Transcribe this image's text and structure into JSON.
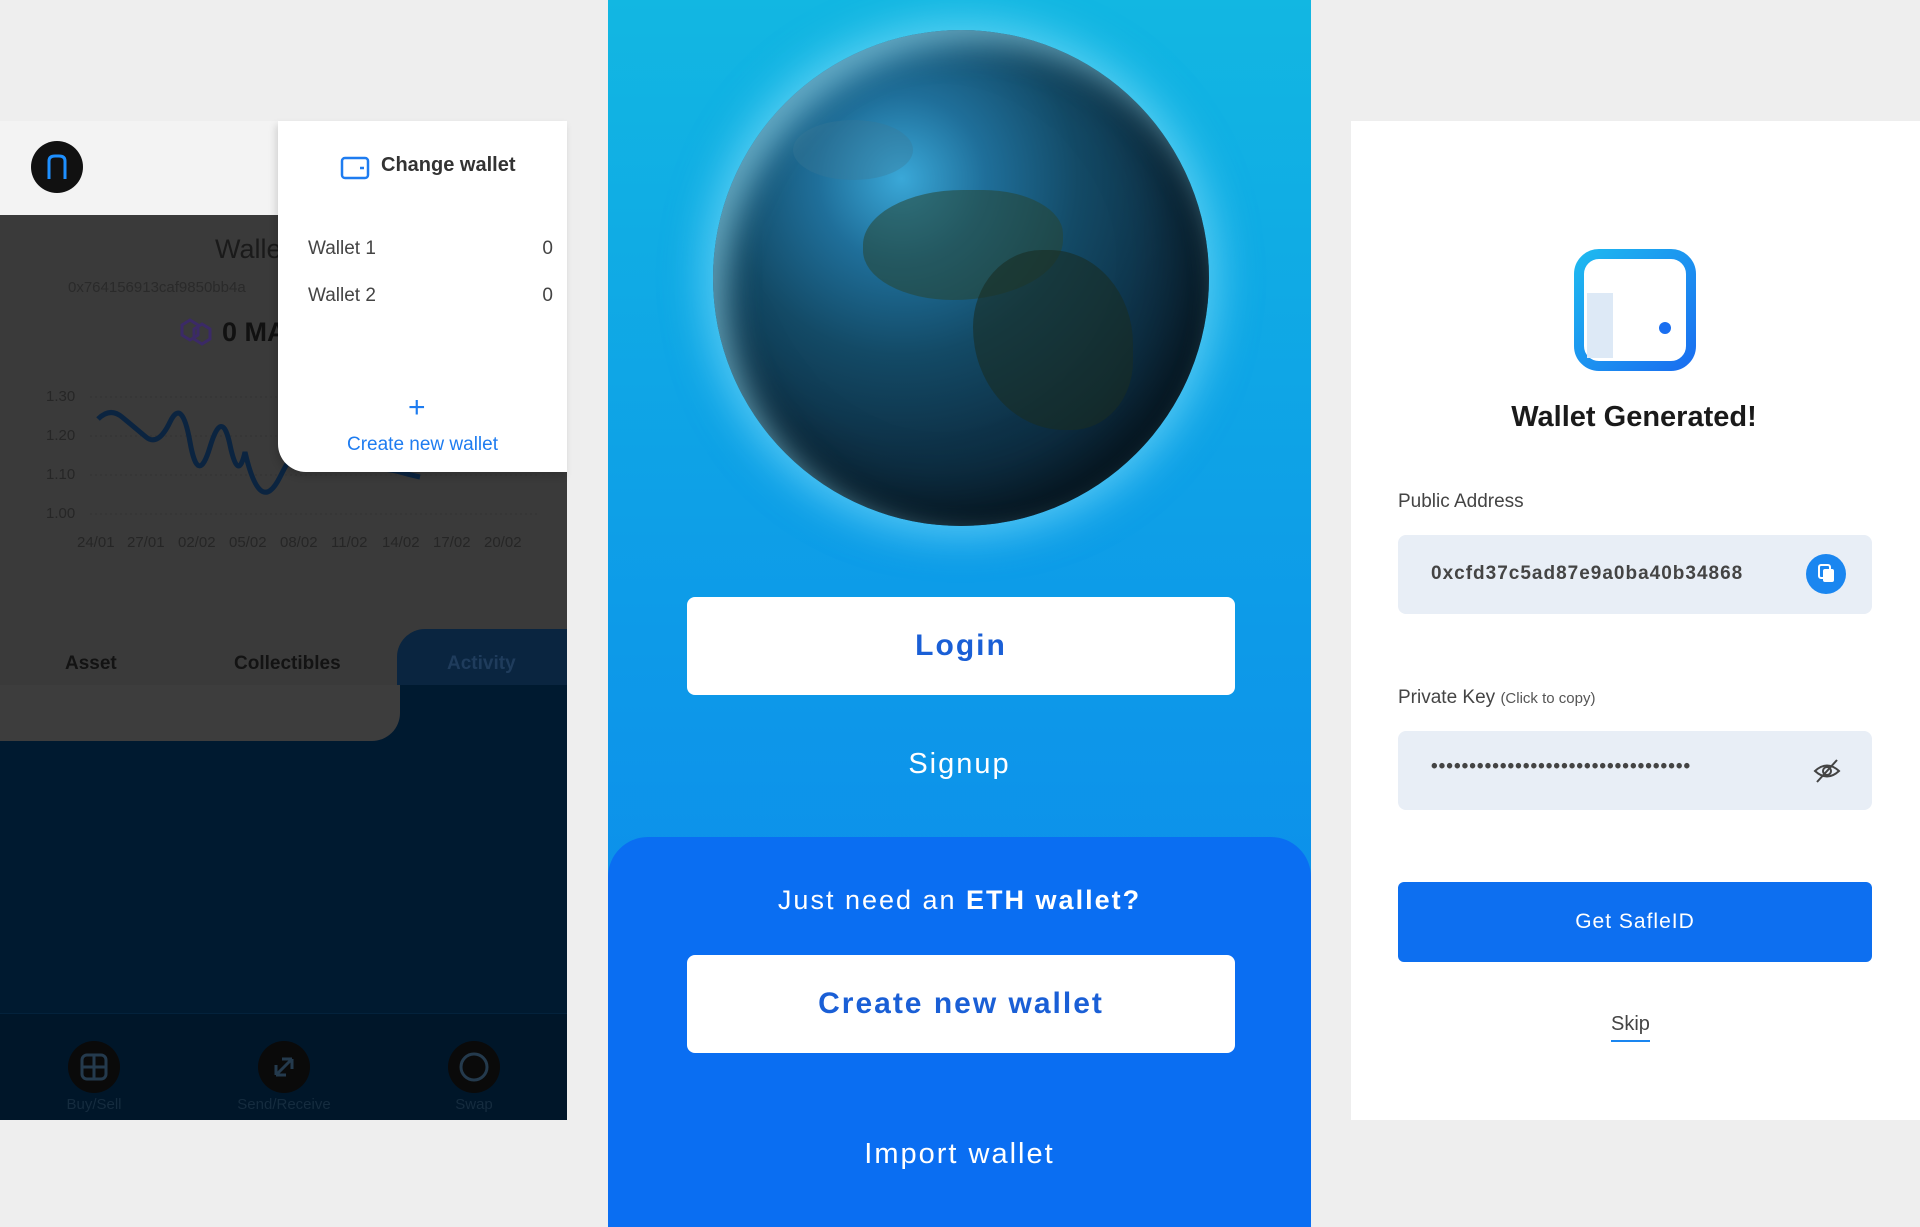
{
  "left_panel": {
    "wallet_name": "Walle",
    "wallet_address": "0x764156913caf9850bb4a",
    "balance": "0 MA",
    "chart": {
      "y_ticks": [
        "1.30",
        "1.20",
        "1.10",
        "1.00"
      ],
      "x_ticks": [
        "24/01",
        "27/01",
        "02/02",
        "05/02",
        "08/02",
        "11/02",
        "14/02",
        "17/02",
        "20/02"
      ]
    },
    "tabs": [
      "Asset",
      "Collectibles",
      "Activity"
    ],
    "bottom_actions": [
      "Buy/Sell",
      "Send/Receive",
      "Swap"
    ],
    "dropdown": {
      "title": "Change wallet",
      "wallets": [
        {
          "name": "Wallet 1",
          "value": "0"
        },
        {
          "name": "Wallet 2",
          "value": "0"
        }
      ],
      "create_label": "Create new wallet",
      "plus": "+"
    }
  },
  "middle_panel": {
    "login_label": "Login",
    "signup_label": "Signup",
    "eth_prompt_prefix": "Just need an ",
    "eth_prompt_bold": "ETH wallet?",
    "create_label": "Create new wallet",
    "import_label": "Import wallet"
  },
  "right_panel": {
    "title": "Wallet Generated!",
    "public_address_label": "Public Address",
    "public_address_value": "0xcfd37c5ad87e9a0ba40b34868",
    "private_key_label": "Private Key",
    "private_key_hint": "(Click to copy)",
    "private_key_masked": "••••••••••••••••••••••••••••••••••",
    "primary_button": "Get SafleID",
    "skip_label": "Skip"
  },
  "colors": {
    "brand_blue": "#0d6ff0",
    "accent": "#1e7cf0"
  }
}
